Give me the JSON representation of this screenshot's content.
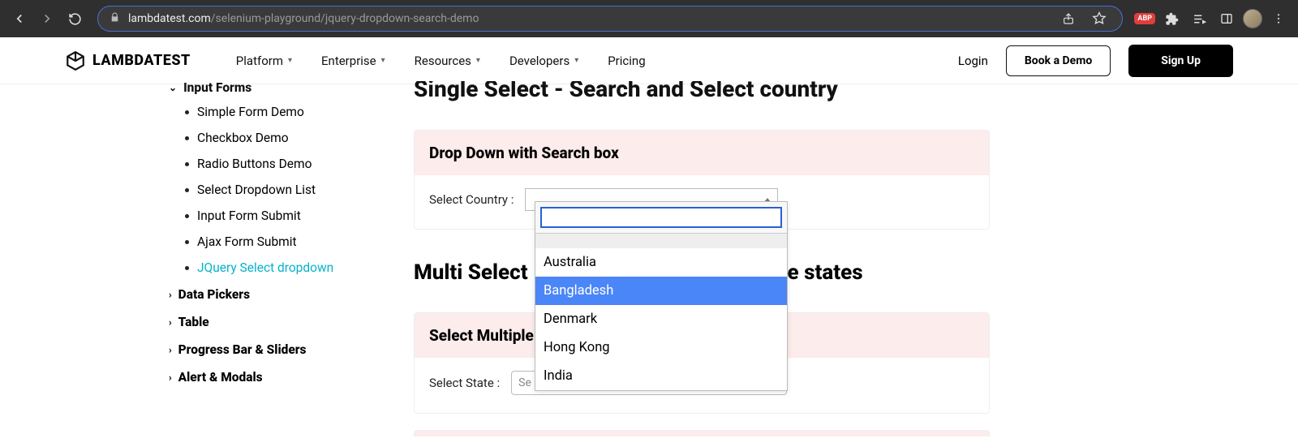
{
  "browser": {
    "url_domain": "lambdatest.com",
    "url_path": "/selenium-playground/jquery-dropdown-search-demo",
    "abp": "ABP"
  },
  "header": {
    "brand": "LAMBDATEST",
    "nav": [
      "Platform",
      "Enterprise",
      "Resources",
      "Developers",
      "Pricing"
    ],
    "login": "Login",
    "demo": "Book a Demo",
    "signup": "Sign Up"
  },
  "sidebar": {
    "group_partial": "Input Forms",
    "items": [
      "Simple Form Demo",
      "Checkbox Demo",
      "Radio Buttons Demo",
      "Select Dropdown List",
      "Input Form Submit",
      "Ajax Form Submit",
      "JQuery Select dropdown"
    ],
    "groups": [
      "Data Pickers",
      "Table",
      "Progress Bar & Sliders",
      "Alert & Modals"
    ]
  },
  "main": {
    "h1_partial": "Single Select - Search and Select country",
    "panel1_title": "Drop Down with Search box",
    "select_country_label": "Select Country :",
    "h2": "Multi Select",
    "h2_suffix": "le states",
    "panel2_title": "Select Multiple",
    "select_state_label": "Select State :",
    "select_state_placeholder": "Se"
  },
  "dropdown": {
    "options": [
      "Australia",
      "Bangladesh",
      "Denmark",
      "Hong Kong",
      "India"
    ],
    "highlight_index": 1
  }
}
